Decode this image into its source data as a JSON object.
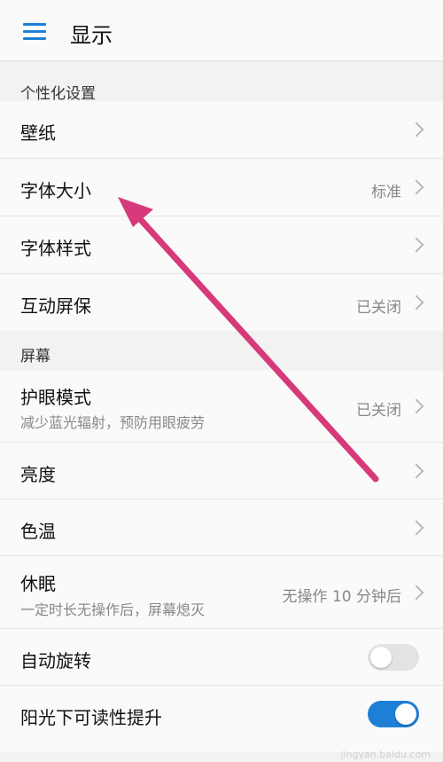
{
  "header": {
    "title": "显示",
    "menu_icon": "menu-icon",
    "accent_color": "#1e7fd6"
  },
  "sections": {
    "personalization": {
      "title": "个性化设置",
      "items": [
        {
          "label": "壁纸",
          "value": ""
        },
        {
          "label": "字体大小",
          "value": "标准"
        },
        {
          "label": "字体样式",
          "value": ""
        },
        {
          "label": "互动屏保",
          "value": "已关闭"
        }
      ]
    },
    "screen": {
      "title": "屏幕",
      "items": [
        {
          "label": "护眼模式",
          "sub": "减少蓝光辐射，预防用眼疲劳",
          "value": "已关闭"
        },
        {
          "label": "亮度",
          "value": ""
        },
        {
          "label": "色温",
          "value": ""
        },
        {
          "label": "休眠",
          "sub": "一定时长无操作后，屏幕熄灭",
          "value": "无操作 10 分钟后"
        },
        {
          "label": "自动旋转",
          "toggle": false
        },
        {
          "label": "阳光下可读性提升",
          "toggle": true
        }
      ]
    }
  },
  "annotation": {
    "arrow_color": "#d63a7a"
  },
  "watermark": "jingyan.baidu.com"
}
